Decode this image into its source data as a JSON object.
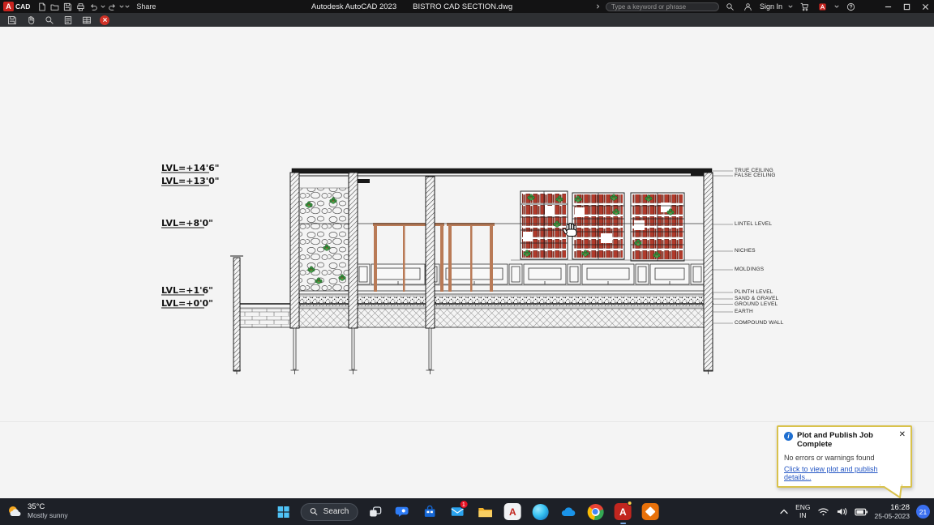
{
  "titlebar": {
    "logo_letter": "A",
    "logo_text": "CAD",
    "share_label": "Share",
    "app_title": "Autodesk AutoCAD 2023",
    "doc_title": "BISTRO CAD SECTION.dwg",
    "search_placeholder": "Type a keyword or phrase",
    "sign_in_label": "Sign In"
  },
  "drawing": {
    "levels": [
      "LVL=+14'6\"",
      "LVL=+13'0\"",
      "LVL=+8'0\"",
      "LVL=+1'6\"",
      "LVL=+0'0\""
    ],
    "annotations": [
      "TRUE CEILING",
      "FALSE CEILING",
      "LINTEL LEVEL",
      "NICHES",
      "MOLDINGS",
      "PLINTH LEVEL",
      "SAND & GRAVEL",
      "GROUND LEVEL",
      "EARTH",
      "COMPOUND WALL"
    ]
  },
  "notification": {
    "title": "Plot and Publish Job Complete",
    "body": "No errors or warnings found",
    "link": "Click to view plot and publish details..."
  },
  "taskbar": {
    "weather": {
      "temp": "35°C",
      "desc": "Mostly sunny"
    },
    "search_label": "Search",
    "badges": {
      "mail": "1"
    },
    "tray": {
      "lang_top": "ENG",
      "lang_bottom": "IN",
      "time": "16:28",
      "date": "25-05-2023",
      "notif_count": "21"
    }
  }
}
